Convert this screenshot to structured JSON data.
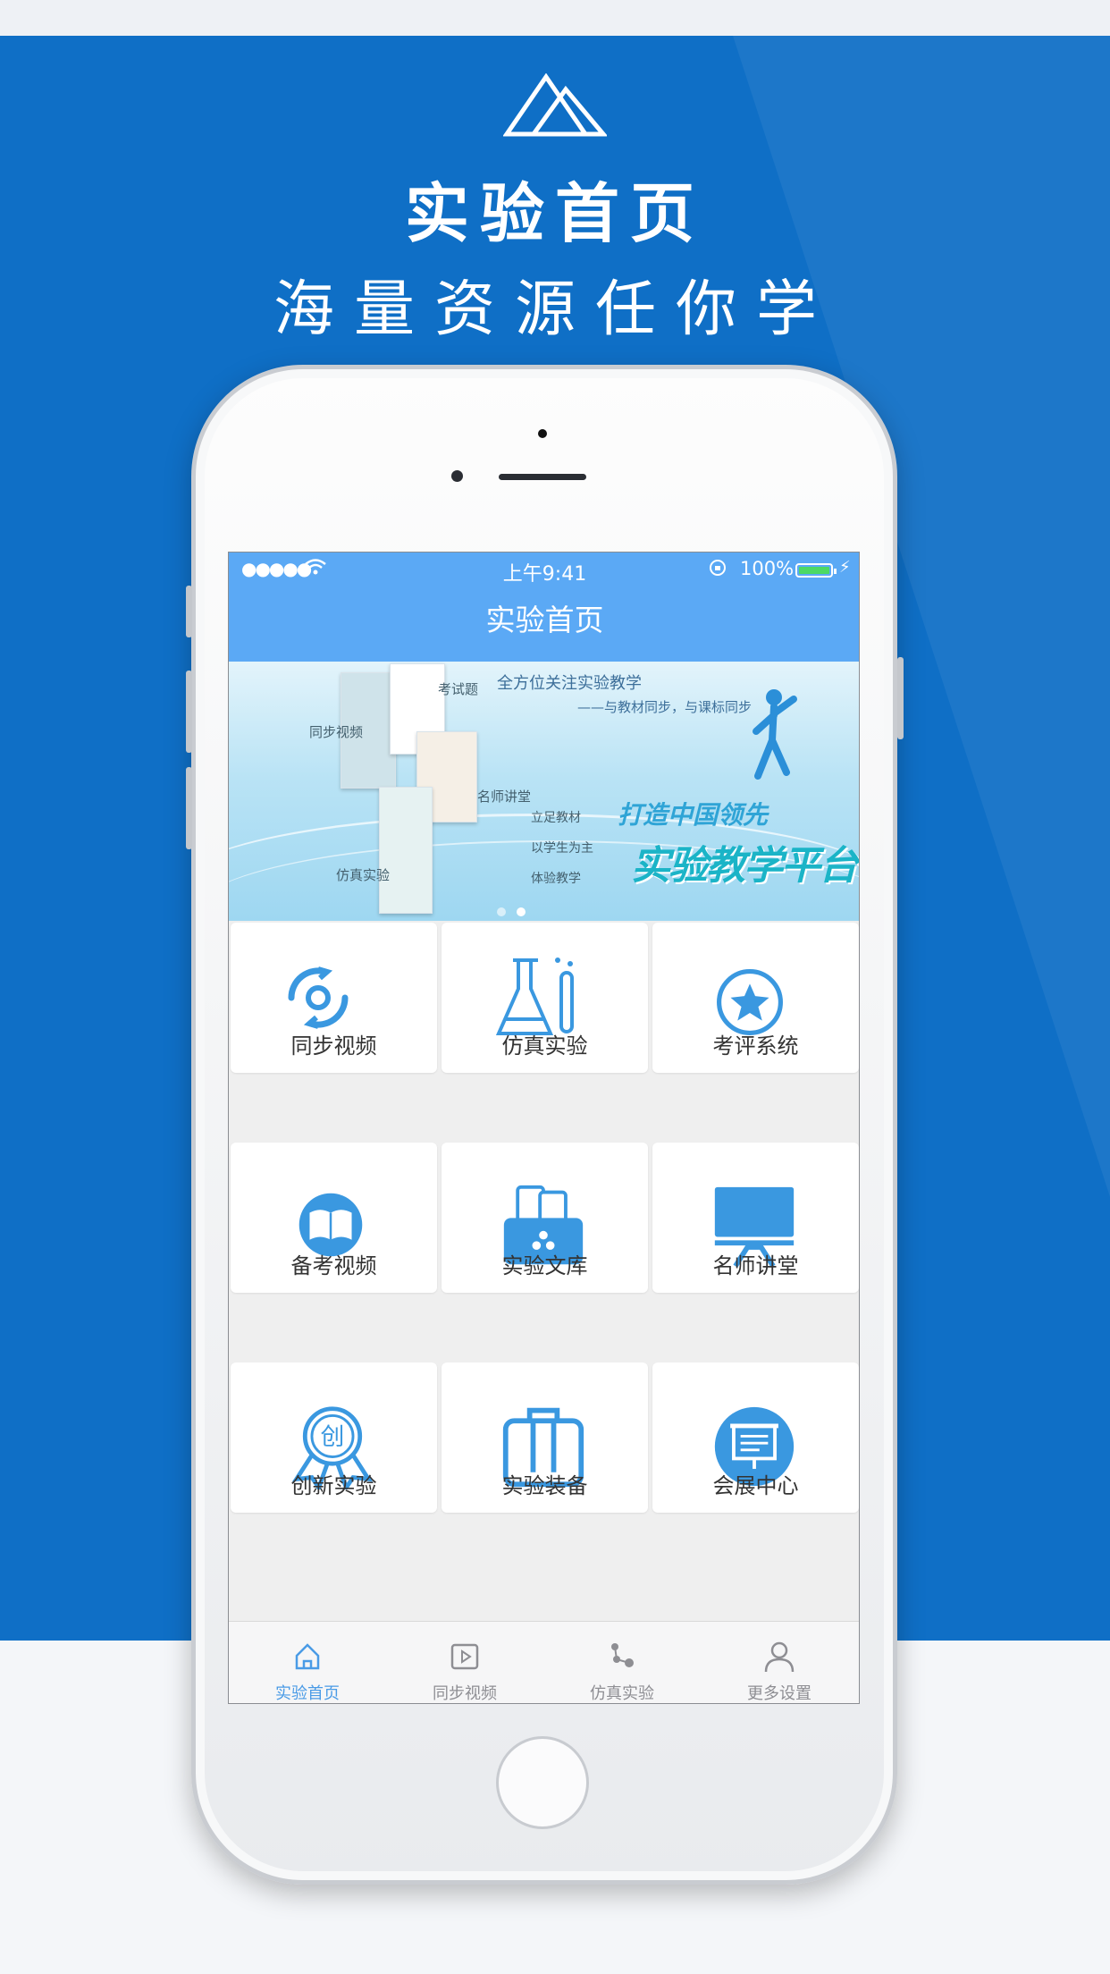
{
  "hero": {
    "logo_icon": "mountain-logo-icon",
    "title": "实验首页",
    "subtitle": "海量资源任你学"
  },
  "status_bar": {
    "signal": "●●●●●",
    "wifi_icon": "wifi-icon",
    "time": "上午9:41",
    "lock_icon": "rotation-lock-icon",
    "battery_percent": "100%",
    "charging_icon": "bolt-icon"
  },
  "nav": {
    "title": "实验首页"
  },
  "banner": {
    "headline": "全方位关注实验教学",
    "subheadline": "——与教材同步，与课标同步",
    "labels": [
      "同步视频",
      "考试题",
      "名师讲堂",
      "仿真实验"
    ],
    "bullets": [
      "立足教材",
      "以学生为主",
      "体验教学"
    ],
    "big_line1": "打造中国领先",
    "big_line2": "实验教学平台",
    "slide_count": 2,
    "active_slide": 2
  },
  "grid": {
    "items": [
      {
        "label": "同步视频",
        "icon": "sync-video-icon"
      },
      {
        "label": "仿真实验",
        "icon": "flask-icon"
      },
      {
        "label": "考评系统",
        "icon": "star-badge-icon"
      },
      {
        "label": "备考视频",
        "icon": "book-icon"
      },
      {
        "label": "实验文库",
        "icon": "library-icon"
      },
      {
        "label": "名师讲堂",
        "icon": "lecture-screen-icon"
      },
      {
        "label": "创新实验",
        "icon": "innovation-medal-icon"
      },
      {
        "label": "实验装备",
        "icon": "equipment-case-icon"
      },
      {
        "label": "会展中心",
        "icon": "exhibition-icon"
      }
    ],
    "medal_char": "创"
  },
  "tab_bar": {
    "items": [
      {
        "label": "实验首页",
        "icon": "home-icon",
        "active": true
      },
      {
        "label": "同步视频",
        "icon": "play-icon",
        "active": false
      },
      {
        "label": "仿真实验",
        "icon": "molecule-icon",
        "active": false
      },
      {
        "label": "更多设置",
        "icon": "user-icon",
        "active": false
      }
    ]
  },
  "colors": {
    "background_blue": "#0f6fc6",
    "nav_blue": "#5ba9f5",
    "icon_blue": "#3a98e0",
    "active_tab": "#4a9be6"
  }
}
